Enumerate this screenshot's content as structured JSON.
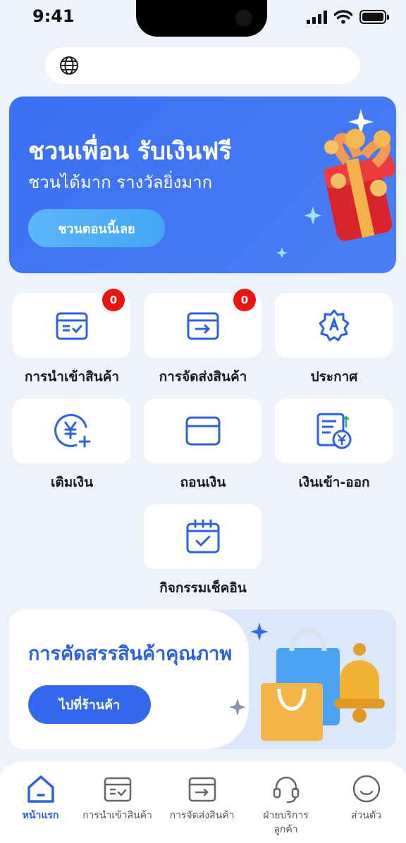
{
  "status_bar": {
    "time": "9:41"
  },
  "search": {
    "placeholder": "",
    "value": ""
  },
  "promo": {
    "title": "ชวนเพื่อน รับเงินฟรี",
    "subtitle": "ชวนได้มาก รางวัลยิ่งมาก",
    "button_label": "ชวนตอนนี้เลย"
  },
  "grid": {
    "items": [
      {
        "label": "การนำเข้าสินค้า",
        "icon": "inbound-box-icon",
        "badge": "0"
      },
      {
        "label": "การจัดส่งสินค้า",
        "icon": "outbound-box-icon",
        "badge": "0"
      },
      {
        "label": "ประกาศ",
        "icon": "announcement-badge-icon"
      },
      {
        "label": "เติมเงิน",
        "icon": "yen-add-icon"
      },
      {
        "label": "ถอนเงิน",
        "icon": "card-icon"
      },
      {
        "label": "เงินเข้า-ออก",
        "icon": "yen-statement-icon"
      },
      {
        "label": "กิจกรรมเช็คอิน",
        "icon": "calendar-check-icon"
      }
    ]
  },
  "featured": {
    "title": "การคัดสรรสินค้าคุณภาพ",
    "button_label": "ไปที่ร้านค้า"
  },
  "bottom_nav": {
    "items": [
      {
        "label": "หน้าแรก",
        "icon": "home-icon",
        "active": true
      },
      {
        "label": "การนำเข้าสินค้า",
        "icon": "inbound-box-icon"
      },
      {
        "label": "การจัดส่งสินค้า",
        "icon": "outbound-box-icon"
      },
      {
        "label": "ฝ่ายบริการ",
        "label2": "ลูกค้า",
        "icon": "headset-icon"
      },
      {
        "label": "ส่วนตัว",
        "icon": "smiley-icon"
      }
    ]
  },
  "colors": {
    "primary": "#3568ec",
    "accent_light": "#4fb0f6",
    "badge_red": "#ee1313",
    "background": "#edf2fb"
  }
}
